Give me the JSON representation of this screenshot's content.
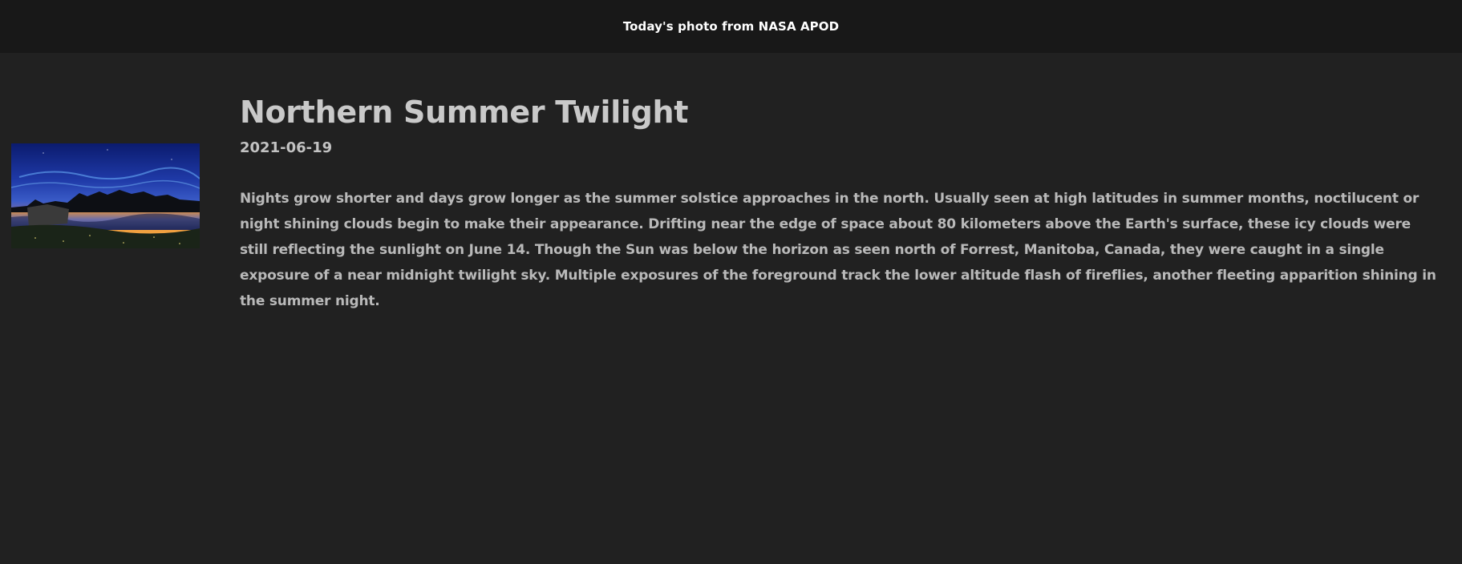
{
  "header": {
    "title": "Today's photo from NASA APOD"
  },
  "apod": {
    "title": "Northern Summer Twilight",
    "date": "2021-06-19",
    "explanation": "Nights grow shorter and days grow longer as the summer solstice approaches in the north. Usually seen at high latitudes in summer months, noctilucent or night shining clouds begin to make their appearance. Drifting near the edge of space about 80 kilometers above the Earth's surface, these icy clouds were still reflecting the sunlight on June 14. Though the Sun was below the horizon as seen north of Forrest, Manitoba, Canada, they were caught in a single exposure of a near midnight twilight sky. Multiple exposures of the foreground track the lower altitude flash of fireflies, another fleeting apparition shining in the summer night."
  },
  "colors": {
    "page_background": "#212121",
    "header_background": "#181818",
    "header_text": "#ffffff",
    "body_text": "#c2c2c2"
  }
}
